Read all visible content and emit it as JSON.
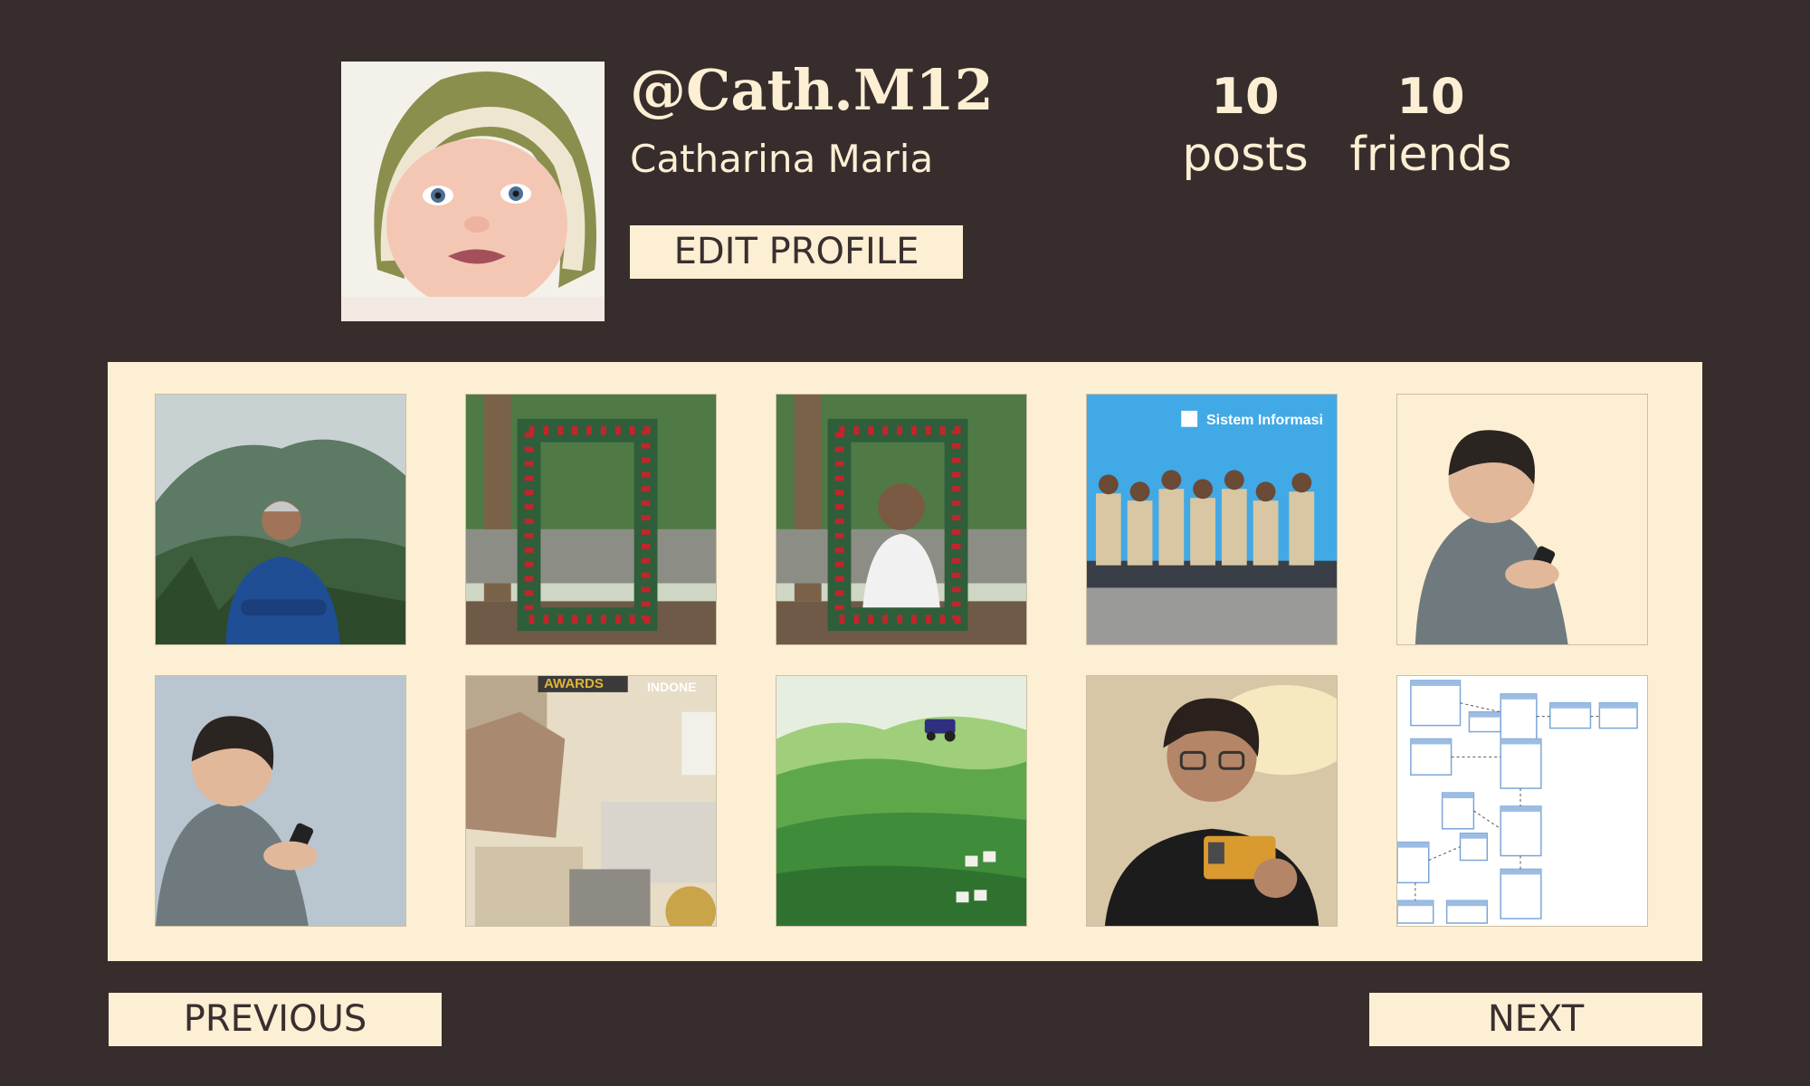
{
  "profile": {
    "handle": "@Cath.M12",
    "full_name": "Catharina Maria",
    "edit_label": "EDIT PROFILE",
    "avatar_icon": "baby-avatar"
  },
  "stats": {
    "posts_count": "10",
    "posts_label": "posts",
    "friends_count": "10",
    "friends_label": "friends"
  },
  "posts": [
    {
      "subject": "man-in-blue-shirt-mountains"
    },
    {
      "subject": "christmas-garland-frame"
    },
    {
      "subject": "man-behind-garland-frame"
    },
    {
      "subject": "group-photo-sistem-informasi",
      "caption": "Sistem Informasi"
    },
    {
      "subject": "young-man-with-phone"
    },
    {
      "subject": "young-man-with-phone-blue-wall"
    },
    {
      "subject": "newspaper-collage",
      "caption": "AWARDS",
      "caption2": "INDONE"
    },
    {
      "subject": "green-farm-illustration"
    },
    {
      "subject": "man-holding-id-card"
    },
    {
      "subject": "database-er-diagram"
    }
  ],
  "navigation": {
    "previous_label": "PREVIOUS",
    "next_label": "NEXT"
  },
  "colors": {
    "background": "#382d2d",
    "panel": "#fcefd3",
    "button_text": "#3a2f2f"
  }
}
